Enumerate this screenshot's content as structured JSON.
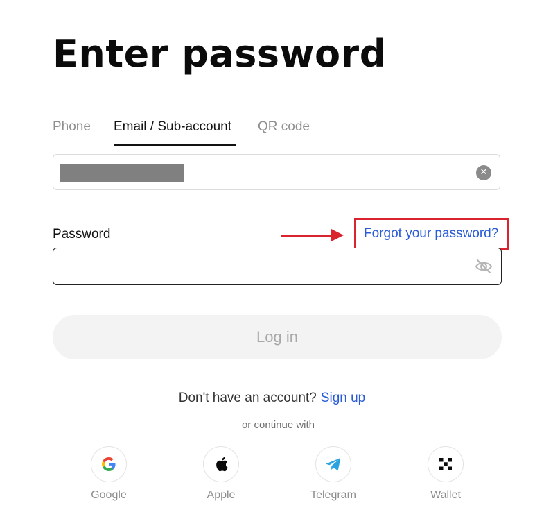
{
  "title": "Enter password",
  "tabs": [
    {
      "label": "Phone",
      "active": false
    },
    {
      "label": "Email / Sub-account",
      "active": true
    },
    {
      "label": "QR code",
      "active": false
    }
  ],
  "email_field": {
    "value_masked": true,
    "clear_icon": "close-icon"
  },
  "password": {
    "label": "Password",
    "forgot_link": "Forgot your password?",
    "value": "",
    "visibility_icon": "eye-off-icon"
  },
  "login_button": {
    "label": "Log in"
  },
  "signup": {
    "prompt": "Don't have an account?",
    "link": "Sign up"
  },
  "divider_text": "or continue with",
  "social": [
    {
      "label": "Google",
      "icon": "google-icon"
    },
    {
      "label": "Apple",
      "icon": "apple-icon"
    },
    {
      "label": "Telegram",
      "icon": "telegram-icon"
    },
    {
      "label": "Wallet",
      "icon": "wallet-icon"
    }
  ],
  "colors": {
    "accent_link": "#2a5bd7",
    "annotation_red": "#d9232f"
  }
}
